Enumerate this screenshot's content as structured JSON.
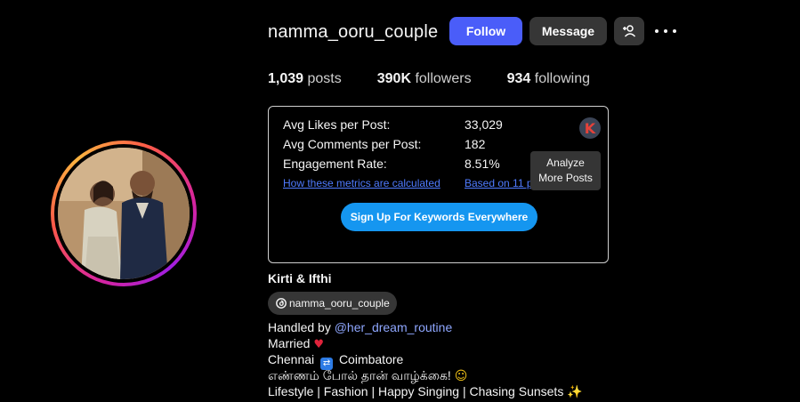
{
  "profile": {
    "username": "namma_ooru_couple",
    "follow_label": "Follow",
    "message_label": "Message",
    "stats": {
      "posts_count": "1,039",
      "posts_label": "posts",
      "followers_count": "390K",
      "followers_label": "followers",
      "following_count": "934",
      "following_label": "following"
    },
    "full_name": "Kirti & Ifthi",
    "threads_handle": "namma_ooru_couple",
    "bio": {
      "handled_by_prefix": "Handled by ",
      "handled_by_mention": "@her_dream_routine",
      "married": "Married",
      "location_from": "Chennai",
      "location_to": "Coimbatore",
      "tamil_line": "எண்ணம் போல் தான் வாழ்க்கை!",
      "interests": "Lifestyle | Fashion | Happy Singing | Chasing Sunsets"
    }
  },
  "metrics": {
    "avg_likes_label": "Avg Likes per Post:",
    "avg_likes_value": "33,029",
    "avg_comments_label": "Avg Comments per Post:",
    "avg_comments_value": "182",
    "engagement_label": "Engagement Rate:",
    "engagement_value": "8.51%",
    "how_link": "How these metrics are calculated",
    "based_link": "Based on 11 p",
    "logo_letter": "K",
    "tooltip_line1": "Analyze",
    "tooltip_line2": "More Posts",
    "signup_label": "Sign Up For Keywords Everywhere"
  },
  "colors": {
    "follow_button": "#4a5df9",
    "secondary_button": "#363636",
    "signup_button": "#1596f0",
    "link": "#4f7bff",
    "mention": "#8fa7ff"
  },
  "icons": {
    "add_user": "person-plus-icon",
    "more": "ellipsis-icon",
    "threads": "threads-icon",
    "logo": "keywords-everywhere-logo"
  }
}
